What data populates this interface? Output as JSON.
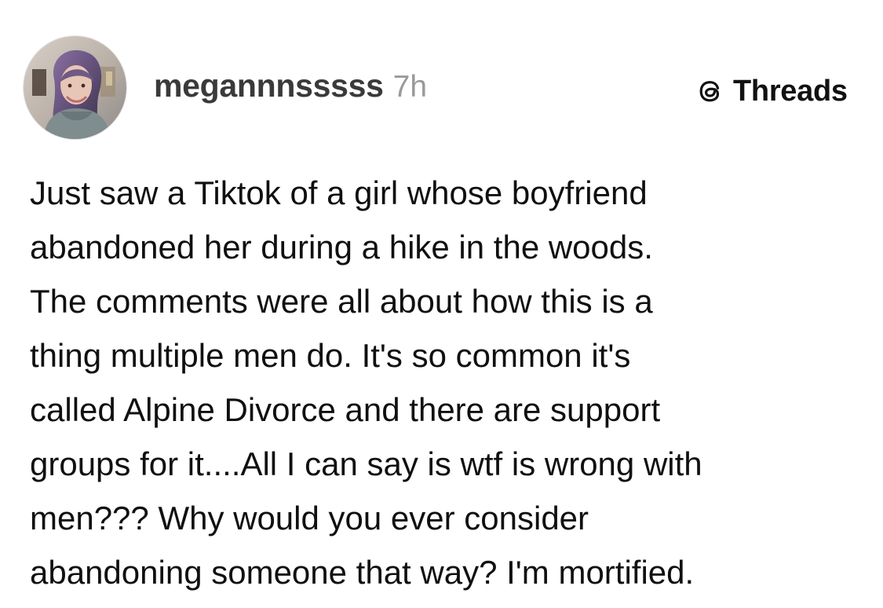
{
  "author": {
    "username": "megannnsssss",
    "timestamp": "7h",
    "avatar_icon": "profile-photo-avatar"
  },
  "brand": {
    "name": "Threads",
    "icon": "threads-logo-icon"
  },
  "post": {
    "lines": [
      "Just saw a Tiktok of a girl whose boyfriend",
      "abandoned her during a hike in the woods.",
      "The comments were all about how this is a",
      "thing multiple men do. It's so common it's",
      "called Alpine Divorce and there are support",
      "groups for it....All I can say is wtf is wrong with",
      "men??? Why would you ever consider",
      "abandoning someone that way?  I'm mortified."
    ]
  },
  "colors": {
    "background": "#ffffff",
    "username": "#3a3a3a",
    "timestamp": "#9a9a9a",
    "body_text": "#101010",
    "brand": "#111111"
  }
}
